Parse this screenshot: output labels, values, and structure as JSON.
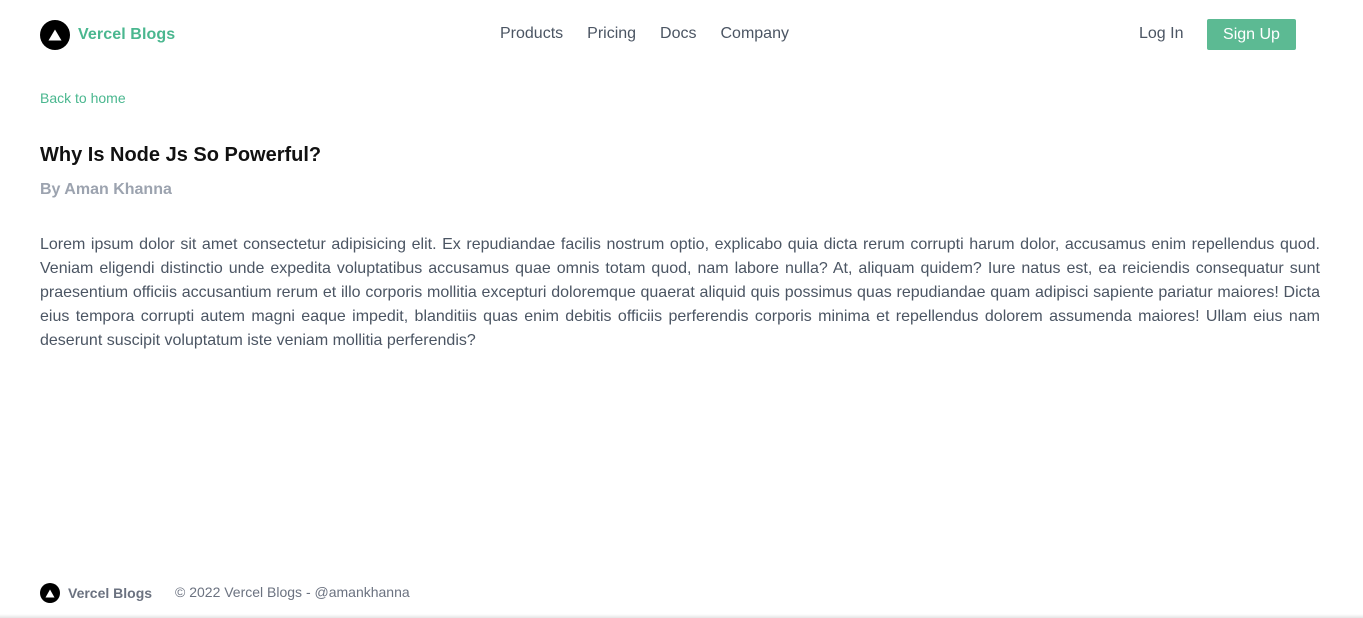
{
  "header": {
    "brand": "Vercel Blogs",
    "nav": [
      {
        "label": "Products"
      },
      {
        "label": "Pricing"
      },
      {
        "label": "Docs"
      },
      {
        "label": "Company"
      }
    ],
    "login_label": "Log In",
    "signup_label": "Sign Up"
  },
  "main": {
    "back_link": "Back to home",
    "post": {
      "title": "Why Is Node Js So Powerful?",
      "author": "By Aman Khanna",
      "body": "Lorem ipsum dolor sit amet consectetur adipisicing elit. Ex repudiandae facilis nostrum optio, explicabo quia dicta rerum corrupti harum dolor, accusamus enim repellendus quod. Veniam eligendi distinctio unde expedita voluptatibus accusamus quae omnis totam quod, nam labore nulla? At, aliquam quidem? Iure natus est, ea reiciendis consequatur sunt praesentium officiis accusantium rerum et illo corporis mollitia excepturi doloremque quaerat aliquid quis possimus quas repudiandae quam adipisci sapiente pariatur maiores! Dicta eius tempora corrupti autem magni eaque impedit, blanditiis quas enim debitis officiis perferendis corporis minima et repellendus dolorem assumenda maiores! Ullam eius nam deserunt suscipit voluptatum iste veniam mollitia perferendis?"
    }
  },
  "footer": {
    "brand": "Vercel Blogs",
    "copyright": "© 2022 Vercel Blogs - @amankhanna"
  },
  "icons": {
    "logo": "triangle-logo-icon"
  },
  "colors": {
    "accent": "#4ab78f",
    "button": "#5cba93",
    "text": "#4b5563",
    "muted": "#9ca3af"
  }
}
